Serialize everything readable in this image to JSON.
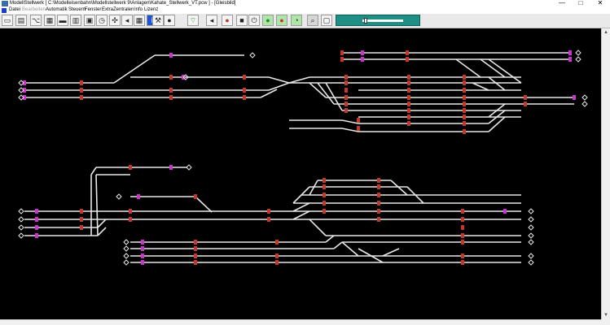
{
  "window": {
    "title": "ModellStellwerk [ C:\\Modelleisenbahn\\Modellstellwerk 9\\Anlagen\\Kahate_Stellwerk_VT.pcw ] - [Gleisbild]"
  },
  "menubar": {
    "items": [
      {
        "label": "Datei",
        "enabled": true
      },
      {
        "label": "Bearbeiten",
        "enabled": false
      },
      {
        "label": "Automatik",
        "enabled": true
      },
      {
        "label": "Steuern",
        "enabled": true
      },
      {
        "label": "Fenster",
        "enabled": true
      },
      {
        "label": "Extra",
        "enabled": true
      },
      {
        "label": "Zentralen",
        "enabled": true
      },
      {
        "label": "Info",
        "enabled": true
      },
      {
        "label": "Lizenz",
        "enabled": true
      }
    ]
  },
  "toolbar": {
    "buttons": [
      {
        "icon": "disk-icon"
      },
      {
        "icon": "save-icon"
      },
      {
        "icon": "track-edit-icon"
      },
      {
        "icon": "signal-box-icon"
      },
      {
        "icon": "locomotive-icon"
      },
      {
        "icon": "calculator-icon"
      },
      {
        "icon": "film-icon"
      },
      {
        "icon": "clock-icon"
      },
      {
        "icon": "controller-icon"
      },
      {
        "icon": "speaker-icon"
      },
      {
        "icon": "grid-icon"
      },
      {
        "icon": "info-icon"
      },
      {
        "icon": "tools-icon"
      },
      {
        "icon": "signal-icon"
      },
      {
        "icon": "wireless-icon"
      },
      {
        "icon": "sound-on-icon"
      },
      {
        "icon": "record-icon"
      },
      {
        "icon": "stop-icon"
      },
      {
        "icon": "power-icon"
      },
      {
        "icon": "go-green-icon"
      },
      {
        "icon": "stop-red-icon"
      },
      {
        "icon": "ghost-icon"
      },
      {
        "icon": "zoom-icon"
      },
      {
        "icon": "layout-icon"
      }
    ]
  },
  "speed": {
    "level": 0.05
  },
  "colors": {
    "track": "#e8e8e8",
    "signal": "#c0392b",
    "marker": "#cc33cc",
    "panel": "#1f8f86"
  }
}
